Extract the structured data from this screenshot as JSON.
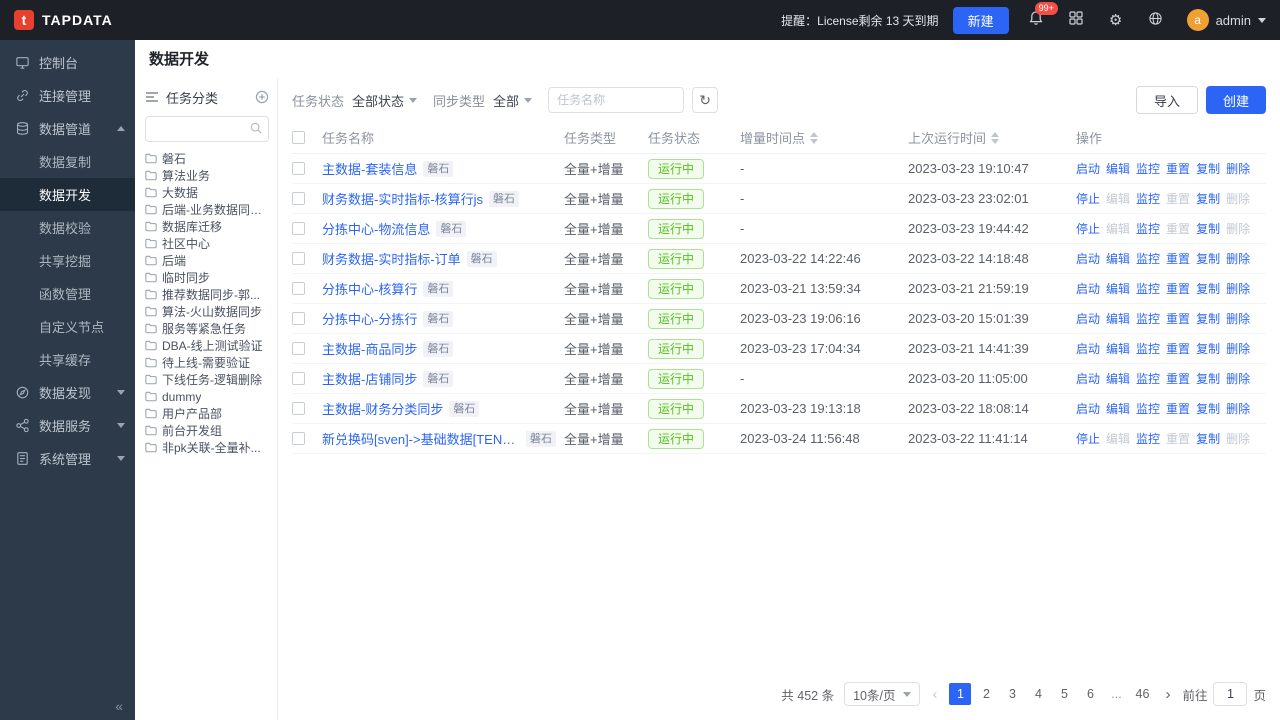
{
  "colors": {
    "accent": "#2c65f6",
    "success": "#52c41a",
    "navbar_bg": "#1d2127",
    "sidebar_bg": "#2c3a49",
    "danger": "#f54e45"
  },
  "icons": {
    "refresh": "↻",
    "gear": "⚙",
    "sidebar_collapse": "«"
  },
  "navbar": {
    "brand": "TAPDATA",
    "license_text": "提醒：License剩余 13 天到期",
    "new_button": "新建",
    "notification_badge": "99+",
    "user_initial": "a",
    "user_name": "admin"
  },
  "sidebar": {
    "console": "控制台",
    "connections": "连接管理",
    "pipeline": "数据管道",
    "pipeline_children": [
      "数据复制",
      "数据开发",
      "数据校验",
      "共享挖掘",
      "函数管理",
      "自定义节点",
      "共享缓存"
    ],
    "active_child": "数据开发",
    "discovery": "数据发现",
    "services": "数据服务",
    "system": "系统管理"
  },
  "page": {
    "title": "数据开发"
  },
  "tree": {
    "title": "任务分类",
    "items": [
      "磐石",
      "算法业务",
      "大数据",
      "后端-业务数据同步...",
      "数据库迁移",
      "社区中心",
      "后端",
      "临时同步",
      "推荐数据同步-郭...",
      "算法-火山数据同步",
      "服务等紧急任务",
      "DBA-线上测试验证",
      "待上线-需要验证",
      "下线任务-逻辑删除",
      "dummy",
      "用户产品部",
      "前台开发组",
      "非pk关联-全量补..."
    ]
  },
  "toolbar": {
    "status_filter_label": "任务状态",
    "status_filter_value": "全部状态",
    "type_filter_label": "同步类型",
    "type_filter_value": "全部",
    "search_placeholder": "任务名称",
    "import_button": "导入",
    "create_button": "创建"
  },
  "table": {
    "columns": [
      "任务名称",
      "任务类型",
      "任务状态",
      "增量时间点",
      "上次运行时间",
      "操作"
    ],
    "rows": [
      {
        "name": "主数据-套装信息",
        "tag": "磐石",
        "type": "全量+增量",
        "status": "运行中",
        "incremental_time": "-",
        "last_run_time": "2023-03-23 19:10:47",
        "actions": [
          {
            "key": "start",
            "label": "启动",
            "enabled": true
          },
          {
            "key": "edit",
            "label": "编辑",
            "enabled": true
          },
          {
            "key": "monitor",
            "label": "监控",
            "enabled": true
          },
          {
            "key": "reset",
            "label": "重置",
            "enabled": true
          },
          {
            "key": "copy",
            "label": "复制",
            "enabled": true
          },
          {
            "key": "delete",
            "label": "删除",
            "enabled": true
          }
        ]
      },
      {
        "name": "财务数据-实时指标-核算行js",
        "tag": "磐石",
        "type": "全量+增量",
        "status": "运行中",
        "incremental_time": "-",
        "last_run_time": "2023-03-23 23:02:01",
        "actions": [
          {
            "key": "stop",
            "label": "停止",
            "enabled": true
          },
          {
            "key": "edit",
            "label": "编辑",
            "enabled": false
          },
          {
            "key": "monitor",
            "label": "监控",
            "enabled": true
          },
          {
            "key": "reset",
            "label": "重置",
            "enabled": false
          },
          {
            "key": "copy",
            "label": "复制",
            "enabled": true
          },
          {
            "key": "delete",
            "label": "删除",
            "enabled": false
          }
        ]
      },
      {
        "name": "分拣中心-物流信息",
        "tag": "磐石",
        "type": "全量+增量",
        "status": "运行中",
        "incremental_time": "-",
        "last_run_time": "2023-03-23 19:44:42",
        "actions": [
          {
            "key": "stop",
            "label": "停止",
            "enabled": true
          },
          {
            "key": "edit",
            "label": "编辑",
            "enabled": false
          },
          {
            "key": "monitor",
            "label": "监控",
            "enabled": true
          },
          {
            "key": "reset",
            "label": "重置",
            "enabled": false
          },
          {
            "key": "copy",
            "label": "复制",
            "enabled": true
          },
          {
            "key": "delete",
            "label": "删除",
            "enabled": false
          }
        ]
      },
      {
        "name": "财务数据-实时指标-订单",
        "tag": "磐石",
        "type": "全量+增量",
        "status": "运行中",
        "incremental_time": "2023-03-22 14:22:46",
        "last_run_time": "2023-03-22 14:18:48",
        "actions": [
          {
            "key": "start",
            "label": "启动",
            "enabled": true
          },
          {
            "key": "edit",
            "label": "编辑",
            "enabled": true
          },
          {
            "key": "monitor",
            "label": "监控",
            "enabled": true
          },
          {
            "key": "reset",
            "label": "重置",
            "enabled": true
          },
          {
            "key": "copy",
            "label": "复制",
            "enabled": true
          },
          {
            "key": "delete",
            "label": "删除",
            "enabled": true
          }
        ]
      },
      {
        "name": "分拣中心-核算行",
        "tag": "磐石",
        "type": "全量+增量",
        "status": "运行中",
        "incremental_time": "2023-03-21 13:59:34",
        "last_run_time": "2023-03-21 21:59:19",
        "actions": [
          {
            "key": "start",
            "label": "启动",
            "enabled": true
          },
          {
            "key": "edit",
            "label": "编辑",
            "enabled": true
          },
          {
            "key": "monitor",
            "label": "监控",
            "enabled": true
          },
          {
            "key": "reset",
            "label": "重置",
            "enabled": true
          },
          {
            "key": "copy",
            "label": "复制",
            "enabled": true
          },
          {
            "key": "delete",
            "label": "删除",
            "enabled": true
          }
        ]
      },
      {
        "name": "分拣中心-分拣行",
        "tag": "磐石",
        "type": "全量+增量",
        "status": "运行中",
        "incremental_time": "2023-03-23 19:06:16",
        "last_run_time": "2023-03-20 15:01:39",
        "actions": [
          {
            "key": "start",
            "label": "启动",
            "enabled": true
          },
          {
            "key": "edit",
            "label": "编辑",
            "enabled": true
          },
          {
            "key": "monitor",
            "label": "监控",
            "enabled": true
          },
          {
            "key": "reset",
            "label": "重置",
            "enabled": true
          },
          {
            "key": "copy",
            "label": "复制",
            "enabled": true
          },
          {
            "key": "delete",
            "label": "删除",
            "enabled": true
          }
        ]
      },
      {
        "name": "主数据-商品同步",
        "tag": "磐石",
        "type": "全量+增量",
        "status": "运行中",
        "incremental_time": "2023-03-23 17:04:34",
        "last_run_time": "2023-03-21 14:41:39",
        "actions": [
          {
            "key": "start",
            "label": "启动",
            "enabled": true
          },
          {
            "key": "edit",
            "label": "编辑",
            "enabled": true
          },
          {
            "key": "monitor",
            "label": "监控",
            "enabled": true
          },
          {
            "key": "reset",
            "label": "重置",
            "enabled": true
          },
          {
            "key": "copy",
            "label": "复制",
            "enabled": true
          },
          {
            "key": "delete",
            "label": "删除",
            "enabled": true
          }
        ]
      },
      {
        "name": "主数据-店铺同步",
        "tag": "磐石",
        "type": "全量+增量",
        "status": "运行中",
        "incremental_time": "-",
        "last_run_time": "2023-03-20 11:05:00",
        "actions": [
          {
            "key": "start",
            "label": "启动",
            "enabled": true
          },
          {
            "key": "edit",
            "label": "编辑",
            "enabled": true
          },
          {
            "key": "monitor",
            "label": "监控",
            "enabled": true
          },
          {
            "key": "reset",
            "label": "重置",
            "enabled": true
          },
          {
            "key": "copy",
            "label": "复制",
            "enabled": true
          },
          {
            "key": "delete",
            "label": "删除",
            "enabled": true
          }
        ]
      },
      {
        "name": "主数据-财务分类同步",
        "tag": "磐石",
        "type": "全量+增量",
        "status": "运行中",
        "incremental_time": "2023-03-23 19:13:18",
        "last_run_time": "2023-03-22 18:08:14",
        "actions": [
          {
            "key": "start",
            "label": "启动",
            "enabled": true
          },
          {
            "key": "edit",
            "label": "编辑",
            "enabled": true
          },
          {
            "key": "monitor",
            "label": "监控",
            "enabled": true
          },
          {
            "key": "reset",
            "label": "重置",
            "enabled": true
          },
          {
            "key": "copy",
            "label": "复制",
            "enabled": true
          },
          {
            "key": "delete",
            "label": "删除",
            "enabled": true
          }
        ]
      },
      {
        "name": "新兑换码[sven]->基础数据[TENON]",
        "tag": "磐石",
        "type": "全量+增量",
        "status": "运行中",
        "incremental_time": "2023-03-24 11:56:48",
        "last_run_time": "2023-03-22 11:41:14",
        "actions": [
          {
            "key": "stop",
            "label": "停止",
            "enabled": true
          },
          {
            "key": "edit",
            "label": "编辑",
            "enabled": false
          },
          {
            "key": "monitor",
            "label": "监控",
            "enabled": true
          },
          {
            "key": "reset",
            "label": "重置",
            "enabled": false
          },
          {
            "key": "copy",
            "label": "复制",
            "enabled": true
          },
          {
            "key": "delete",
            "label": "删除",
            "enabled": false
          }
        ]
      }
    ]
  },
  "pagination": {
    "total_text": "共 452 条",
    "page_size": "10条/页",
    "pages": [
      "1",
      "2",
      "3",
      "4",
      "5",
      "6",
      "...",
      "46"
    ],
    "active_page": "1",
    "goto_label": "前往",
    "goto_value": "1",
    "goto_suffix": "页"
  }
}
